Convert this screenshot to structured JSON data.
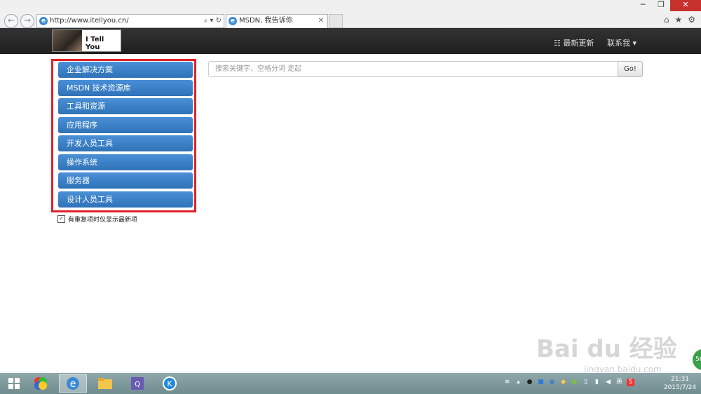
{
  "browser": {
    "url": "http://www.itellyou.cn/",
    "tab_title": "MSDN, 我告诉你"
  },
  "site": {
    "logo_text": "I Tell You",
    "nav": {
      "updates": "最新更新",
      "contact": "联系我"
    }
  },
  "sidebar": {
    "items": [
      {
        "label": "企业解决方案"
      },
      {
        "label": "MSDN 技术资源库"
      },
      {
        "label": "工具和资源"
      },
      {
        "label": "应用程序"
      },
      {
        "label": "开发人员工具"
      },
      {
        "label": "操作系统"
      },
      {
        "label": "服务器"
      },
      {
        "label": "设计人员工具"
      }
    ],
    "checkbox_label": "有重复项时仅显示最新项"
  },
  "search": {
    "placeholder": "搜索关键字，空格分词 走起",
    "button": "Go!"
  },
  "taskbar": {
    "time": "21:31",
    "date": "2015/7/24",
    "tray_ime": "英"
  },
  "watermark": {
    "brand": "Bai du 经验",
    "url": "jingyan.baidu.com"
  },
  "badge": "56",
  "colors": {
    "menu_blue": "#3a82c8",
    "highlight_red": "#e1212b",
    "header_dark": "#2a2a2a"
  }
}
